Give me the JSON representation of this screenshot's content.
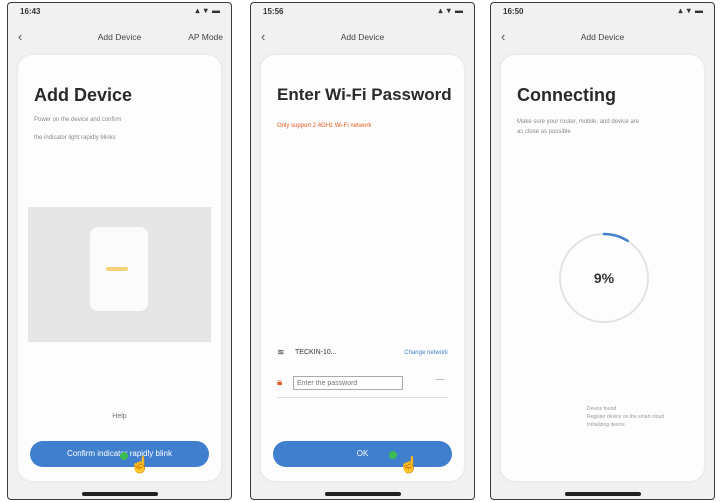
{
  "screen1": {
    "time": "16:43",
    "signal_icons": "▴ ▾ ▬",
    "nav_title": "Add Device",
    "nav_right": "AP Mode",
    "heading": "Add Device",
    "description_line1": "Power on the device and confirm",
    "description_line2": "the indicator light rapidly blinks",
    "help_text": "Help",
    "button_label": "Confirm indicator rapidly blink"
  },
  "screen2": {
    "time": "15:56",
    "signal_icons": "▴ ▾ ▬",
    "nav_title": "Add Device",
    "heading": "Enter Wi-Fi Password",
    "warning": "Only support 2.4GHz Wi-Fi network",
    "wifi_name": "TECKIN-10...",
    "change_network": "Change network",
    "password_placeholder": "Enter the password",
    "button_label": "OK"
  },
  "screen3": {
    "time": "16:50",
    "signal_icons": "▴ ▾ ▬",
    "nav_title": "Add Device",
    "heading": "Connecting",
    "description": "Make sure your router, mobile, and device are as close as possible",
    "progress_text": "9%",
    "progress": 0.09,
    "notes_line1": "Device found",
    "notes_line2": "Register device on the smart cloud",
    "notes_line3": "Initializing device"
  },
  "colors": {
    "accent": "#3f7fce",
    "warning": "#e4581f",
    "tap_dot": "#3dbb53"
  }
}
